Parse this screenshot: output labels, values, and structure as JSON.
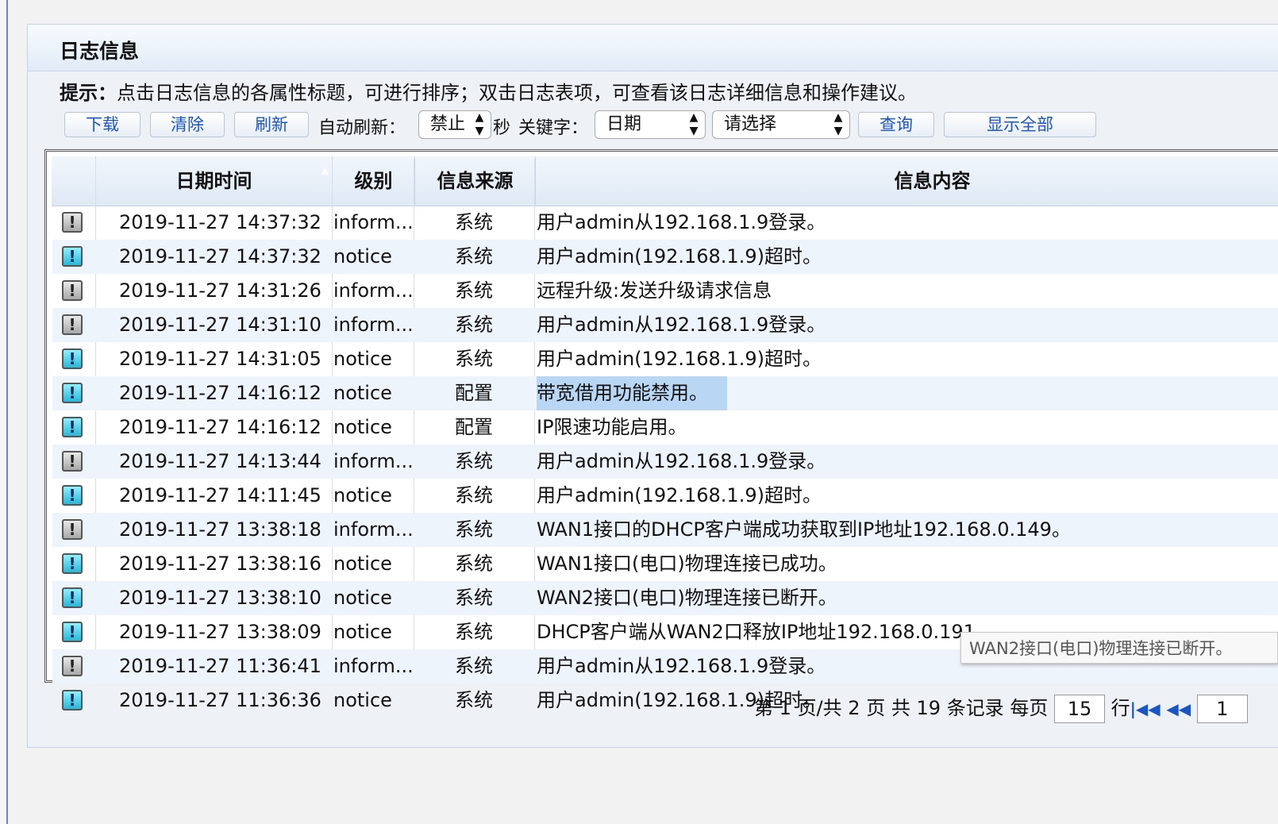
{
  "panel": {
    "title": "日志信息"
  },
  "hint": {
    "label": "提示：",
    "text": "点击日志信息的各属性标题，可进行排序；双击日志表项，可查看该日志详细信息和操作建议。"
  },
  "toolbar": {
    "download": "下载",
    "clear": "清除",
    "refresh": "刷新",
    "auto_refresh_label": "自动刷新：",
    "auto_refresh_value": "禁止",
    "seconds_label": "秒",
    "keyword_label": "关键字：",
    "keyword_field_value": "日期",
    "keyword_value": "请选择",
    "query": "查询",
    "show_all": "显示全部"
  },
  "columns": {
    "datetime": "日期时间",
    "level": "级别",
    "source": "信息来源",
    "content": "信息内容"
  },
  "rows": [
    {
      "icon": "info-icon",
      "datetime": "2019-11-27 14:37:32",
      "level": "inform...",
      "source": "系统",
      "content": "用户admin从192.168.1.9登录。"
    },
    {
      "icon": "notice-icon",
      "datetime": "2019-11-27 14:37:32",
      "level": "notice",
      "source": "系统",
      "content": "用户admin(192.168.1.9)超时。"
    },
    {
      "icon": "info-icon",
      "datetime": "2019-11-27 14:31:26",
      "level": "inform...",
      "source": "系统",
      "content": "远程升级:发送升级请求信息"
    },
    {
      "icon": "info-icon",
      "datetime": "2019-11-27 14:31:10",
      "level": "inform...",
      "source": "系统",
      "content": "用户admin从192.168.1.9登录。"
    },
    {
      "icon": "notice-icon",
      "datetime": "2019-11-27 14:31:05",
      "level": "notice",
      "source": "系统",
      "content": "用户admin(192.168.1.9)超时。"
    },
    {
      "icon": "notice-icon",
      "datetime": "2019-11-27 14:16:12",
      "level": "notice",
      "source": "配置",
      "content": "带宽借用功能禁用。",
      "selected": true
    },
    {
      "icon": "notice-icon",
      "datetime": "2019-11-27 14:16:12",
      "level": "notice",
      "source": "配置",
      "content": "IP限速功能启用。"
    },
    {
      "icon": "info-icon",
      "datetime": "2019-11-27 14:13:44",
      "level": "inform...",
      "source": "系统",
      "content": "用户admin从192.168.1.9登录。"
    },
    {
      "icon": "notice-icon",
      "datetime": "2019-11-27 14:11:45",
      "level": "notice",
      "source": "系统",
      "content": "用户admin(192.168.1.9)超时。"
    },
    {
      "icon": "info-icon",
      "datetime": "2019-11-27 13:38:18",
      "level": "inform...",
      "source": "系统",
      "content": "WAN1接口的DHCP客户端成功获取到IP地址192.168.0.149。"
    },
    {
      "icon": "notice-icon",
      "datetime": "2019-11-27 13:38:16",
      "level": "notice",
      "source": "系统",
      "content": "WAN1接口(电口)物理连接已成功。"
    },
    {
      "icon": "notice-icon",
      "datetime": "2019-11-27 13:38:10",
      "level": "notice",
      "source": "系统",
      "content": "WAN2接口(电口)物理连接已断开。"
    },
    {
      "icon": "notice-icon",
      "datetime": "2019-11-27 13:38:09",
      "level": "notice",
      "source": "系统",
      "content": "DHCP客户端从WAN2口释放IP地址192.168.0.191。"
    },
    {
      "icon": "info-icon",
      "datetime": "2019-11-27 11:36:41",
      "level": "inform...",
      "source": "系统",
      "content": "用户admin从192.168.1.9登录。"
    },
    {
      "icon": "notice-icon",
      "datetime": "2019-11-27 11:36:36",
      "level": "notice",
      "source": "系统",
      "content": "用户admin(192.168.1.9)超时。"
    }
  ],
  "pager": {
    "page_prefix": "第",
    "current_page": "1",
    "page_suffix": "页/共",
    "total_pages": "2",
    "pages_label": "页 共",
    "total_records": "19",
    "records_label": "条记录 每页",
    "per_page": "15",
    "rows_label": "行",
    "goto_page": "1"
  },
  "tooltip": {
    "text": "WAN2接口(电口)物理连接已断开。"
  }
}
